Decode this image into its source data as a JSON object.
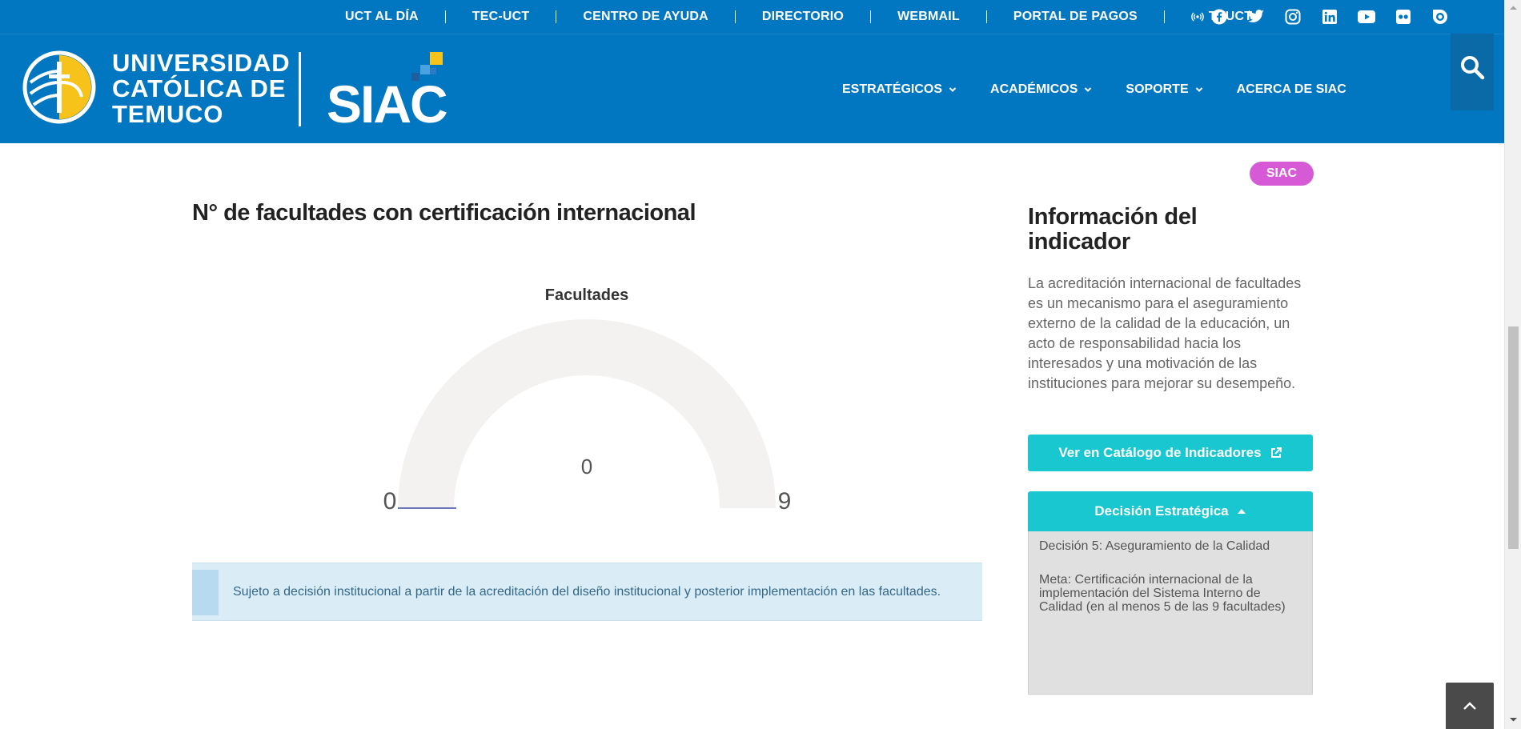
{
  "top_links": [
    {
      "label": "UCT AL DÍA"
    },
    {
      "label": "TEC-UCT"
    },
    {
      "label": "CENTRO DE AYUDA"
    },
    {
      "label": "DIRECTORIO"
    },
    {
      "label": "WEBMAIL"
    },
    {
      "label": "PORTAL DE PAGOS"
    },
    {
      "label": "TVUCT"
    }
  ],
  "social_icons": [
    "facebook-icon",
    "twitter-icon",
    "instagram-icon",
    "linkedin-icon",
    "youtube-icon",
    "flickr-icon",
    "issuu-icon"
  ],
  "header": {
    "university": [
      "UNIVERSIDAD",
      "CATÓLICA DE",
      "TEMUCO"
    ],
    "siac_logo_text": "SIAC",
    "nav": [
      "ESTRATÉGICOS",
      "ACADÉMICOS",
      "SOPORTE",
      "ACERCA DE SIAC"
    ]
  },
  "tag": "SIAC",
  "indicator": {
    "title": "N° de facultades con certificación internacional"
  },
  "chart_data": {
    "type": "gauge",
    "title": "Facultades",
    "value": 0,
    "min": 0,
    "max": 9
  },
  "note": "Sujeto a decisión institucional a partir de la acreditación del diseño institucional y posterior implementación en las facultades.",
  "sidebar": {
    "title": "Información del indicador",
    "description": "La acreditación internacional de facultades es un mecanismo para el aseguramiento externo de la calidad de la educación, un acto de responsabilidad hacia los interesados y una motivación de las instituciones para mejorar su desempeño.",
    "catalog_button": "Ver en Catálogo de Indicadores",
    "decision_button": "Decisión Estratégica",
    "decision": "Decisión 5: Aseguramiento de la Calidad",
    "meta": "Meta: Certificación internacional de la implementación del Sistema Interno de Calidad (en al menos 5 de las 9 facultades)"
  },
  "colors": {
    "brand_blue": "#0077c0",
    "teal": "#19c7d1",
    "tag_pink": "#d65ad6",
    "gauge_track": "#f3f2f1",
    "note_bg": "#daecf6"
  }
}
